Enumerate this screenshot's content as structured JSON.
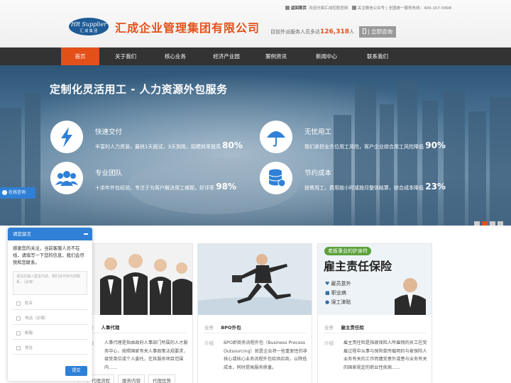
{
  "header": {
    "logo_line1": "HR Supplier",
    "logo_line2": "汇 成 集 团",
    "company_name": "汇成企业管理集团有限公司",
    "top_links": {
      "home": "返回首页",
      "welcome": "欢迎光临汇成控股官网",
      "follow": "关注微信公众号",
      "hotline": "| 全国统一服务热线：400-167-5898"
    },
    "serve_prefix": "目前外派服务人员多达",
    "serve_number": "126,318",
    "serve_suffix": "人",
    "consult_button": "| 立即咨询"
  },
  "nav": {
    "items": [
      "首页",
      "关于我们",
      "核心业务",
      "经济产业园",
      "案例资讯",
      "新闻中心",
      "联系我们"
    ],
    "active_index": 0
  },
  "banner": {
    "title": "定制化灵活用工 - 人力资源外包服务",
    "features": [
      {
        "icon": "lightning-icon",
        "title": "快速交付",
        "desc": "丰富的人力资源，最快1天面试，3天到岗，招聘效率提高",
        "highlight": "80%"
      },
      {
        "icon": "umbrella-icon",
        "title": "无忧用工",
        "desc": "我们承担全方位用工风险，客户企业综合用工风险降低",
        "highlight": "90%"
      },
      {
        "icon": "team-icon",
        "title": "专业团队",
        "desc": "十余年外包经验，专注于为客户解决用工难题，好评率",
        "highlight": "98%"
      },
      {
        "icon": "coins-icon",
        "title": "节约成本",
        "desc": "按需用工，费用按小时或按月整体结算，综合成本降低",
        "highlight": "23%"
      }
    ],
    "slide_count": 4,
    "active_slide": 1
  },
  "online_service": {
    "label": "在线咨询"
  },
  "chat": {
    "title": "请您留言",
    "message": "感谢您的关注，当前客服人员不在线，请填写一下您的信息，我们会尽快和您联系。",
    "textarea_placeholder": "请在此输入留言内容，我们会尽快与您联系。（必填）",
    "fields": [
      "姓名",
      "电话（必填）",
      "邮箱",
      "地址"
    ],
    "submit": "提交"
  },
  "cards": [
    {
      "biz_label": "业务",
      "biz_name": "人事代理",
      "intro_label": "介绍",
      "intro": "人事代理是指由政府人事部门所属的人才服务中心，按照国家有关人事政策法规要求，接受单位或个人委托，在其服务项目范围内......"
    },
    {
      "biz_label": "业务",
      "biz_name": "BPO外包",
      "intro_label": "介绍",
      "intro": "BPO即商务流程外包（Business Process Outsourcing）就是企业将一些重复性的非核心或核心业务流程外包给供应商，以降低成本，同时提高服务质量。"
    },
    {
      "biz_label": "业务",
      "biz_name": "雇主责任险",
      "intro_label": "介绍",
      "intro": "雇主责任险是指被保险人所雇佣的员工在受雇过程中从事与保险单所载明的与被保险人业务有关的工作而遭受意外或患与业务有关的国家规定的职业性疾病......",
      "banner_small": "老板事业的护身符",
      "banner_big": "雇主责任保险",
      "bullets": [
        "雇员意外",
        "职业病",
        "误工津贴"
      ]
    }
  ],
  "tags": [
    "代理流程",
    "服务内容",
    "代理优势"
  ],
  "colors": {
    "accent": "#e4501a",
    "nav": "#333333",
    "chat": "#2f80d6"
  }
}
